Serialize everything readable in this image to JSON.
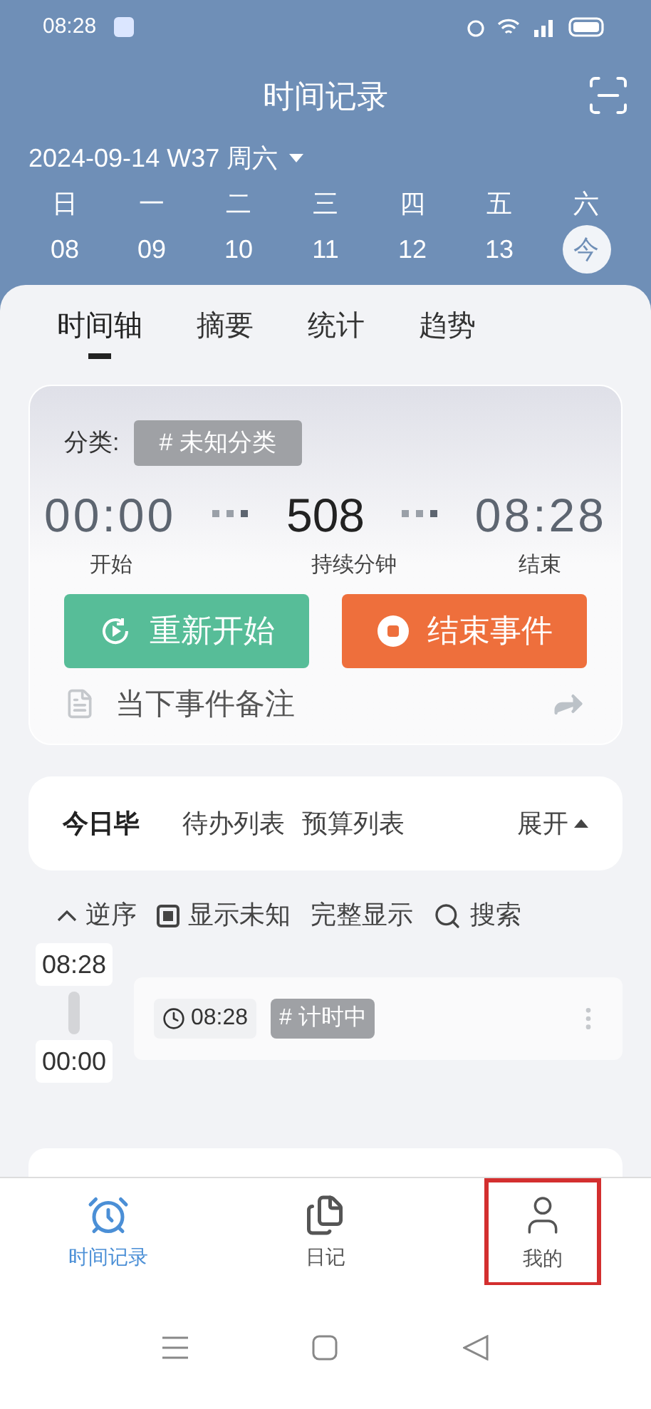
{
  "status_bar": {
    "time": "08:28"
  },
  "header": {
    "title": "时间记录",
    "date_label": "2024-09-14 W37 周六"
  },
  "week": [
    {
      "weekday": "日",
      "day": "08",
      "selected": false
    },
    {
      "weekday": "一",
      "day": "09",
      "selected": false
    },
    {
      "weekday": "二",
      "day": "10",
      "selected": false
    },
    {
      "weekday": "三",
      "day": "11",
      "selected": false
    },
    {
      "weekday": "四",
      "day": "12",
      "selected": false
    },
    {
      "weekday": "五",
      "day": "13",
      "selected": false
    },
    {
      "weekday": "六",
      "day": "今",
      "selected": true
    }
  ],
  "tabs": [
    {
      "label": "时间轴",
      "selected": true
    },
    {
      "label": "摘要",
      "selected": false
    },
    {
      "label": "统计",
      "selected": false
    },
    {
      "label": "趋势",
      "selected": false
    }
  ],
  "event_card": {
    "category_label": "分类:",
    "category": "# 未知分类",
    "start": "00:00",
    "start_label": "开始",
    "duration": "508",
    "duration_label": "持续分钟",
    "end": "08:28",
    "end_label": "结束",
    "restart_button": "重新开始",
    "end_button": "结束事件",
    "note_placeholder": "当下事件备注"
  },
  "lists_bar": [
    {
      "label": "今日毕",
      "selected": true
    },
    {
      "label": "待办列表",
      "selected": false
    },
    {
      "label": "预算列表",
      "selected": false
    }
  ],
  "expand_button": "展开",
  "toolbar": [
    {
      "kind": "sort",
      "label": "逆序"
    },
    {
      "kind": "toggle",
      "label": "显示未知"
    },
    {
      "kind": "plain",
      "label": "完整显示"
    },
    {
      "kind": "search",
      "label": "搜索"
    }
  ],
  "timeline": {
    "top_time": "08:28",
    "bottom_time": "00:00",
    "entry": {
      "time": "08:28",
      "tag": "# 计时中"
    }
  },
  "banner": {
    "kind": "strip"
  },
  "bottom_nav": [
    {
      "label": "时间记录",
      "selected": true,
      "highlighted": false
    },
    {
      "label": "日记",
      "selected": false,
      "highlighted": false
    },
    {
      "label": "我的",
      "selected": false,
      "highlighted": true
    }
  ]
}
